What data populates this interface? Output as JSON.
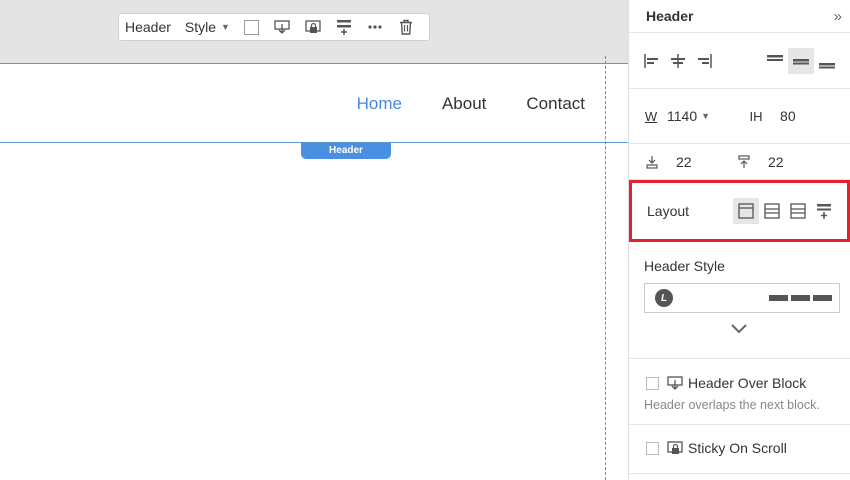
{
  "toolbar": {
    "header_label": "Header",
    "style_label": "Style"
  },
  "canvas": {
    "nav": [
      {
        "label": "Home",
        "active": true
      },
      {
        "label": "About",
        "active": false
      },
      {
        "label": "Contact",
        "active": false
      }
    ],
    "header_tag": "Header"
  },
  "panel": {
    "title": "Header",
    "width_label": "W",
    "width_value": "1140",
    "height_label": "IH",
    "height_value": "80",
    "padding_top": "22",
    "padding_bottom": "22",
    "layout_label": "Layout",
    "header_style_label": "Header Style",
    "header_over_block_label": "Header Over Block",
    "header_over_block_hint": "Header overlaps the next block.",
    "sticky_label": "Sticky On Scroll"
  },
  "colors": {
    "accent": "#4a90e2",
    "highlight_border": "#e0232e"
  }
}
